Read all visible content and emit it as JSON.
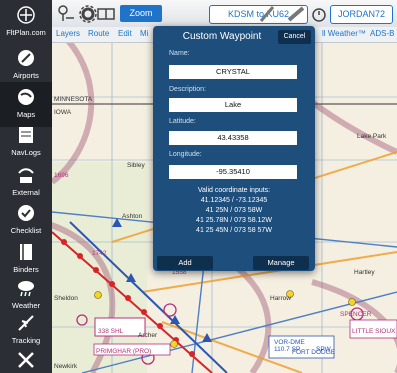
{
  "toolbar": {
    "zoom_label": "Zoom",
    "route_label": "KDSM to KU62",
    "user_label": "JORDAN72"
  },
  "menu": {
    "items": [
      "Layers",
      "Route",
      "Edit",
      "Mi",
      "ll Weather™",
      "ADS-B"
    ]
  },
  "sidebar": {
    "brand": "FltPlan.com",
    "items": [
      {
        "label": "Airports",
        "icon": "airport-icon"
      },
      {
        "label": "Maps",
        "icon": "globe-icon"
      },
      {
        "label": "NavLogs",
        "icon": "navlog-icon"
      },
      {
        "label": "External",
        "icon": "wifi-icon"
      },
      {
        "label": "Checklist",
        "icon": "checklist-icon"
      },
      {
        "label": "Binders",
        "icon": "binder-icon"
      },
      {
        "label": "Weather",
        "icon": "weather-icon"
      },
      {
        "label": "Tracking",
        "icon": "plane-icon"
      },
      {
        "label": "",
        "icon": "tools-icon"
      }
    ]
  },
  "modal": {
    "title": "Custom Waypoint",
    "cancel_label": "Cancel",
    "name_label": "Name:",
    "name_value": "CRYSTAL",
    "description_label": "Description:",
    "description_value": "Lake",
    "latitude_label": "Latitude:",
    "latitude_value": "43.43358",
    "longitude_label": "Longitude:",
    "longitude_value": "-95.35410",
    "valid_title": "Valid coordinate inputs:",
    "valid_lines": [
      "41.12345 / -73.12345",
      "41 25N / 073 58W",
      "41 25.78N / 073 58.12W",
      "41 25 45N / 073 58 57W"
    ],
    "add_label": "Add",
    "manage_label": "Manage"
  },
  "map_labels": {
    "minnesota": "MINNESOTA",
    "iowa": "IOWA",
    "sibley": "Sibley",
    "ashton": "Ashton",
    "sheldon": "Sheldon",
    "primghar": "Primghar",
    "newkirk": "Newkirk",
    "archer": "Archer",
    "harrow": "Harrow",
    "lake_park": "Lake Park",
    "hartley": "Hartley",
    "spencer": "SPENCER",
    "little_sioux": "LITTLE SIOUX",
    "fort_dodge": "FORT DODGE",
    "n1696": "1696",
    "n1742": "1742",
    "n1558": "1558",
    "n1622": "1622",
    "sheldon_freq": "338 SHL",
    "primghar_box": "PRIMGHAR (PRO)",
    "vor_dme": "VOR-DME",
    "freq": "110.7 SP",
    "spw": "SPW"
  },
  "colors": {
    "accent": "#1f73c9",
    "modal_bg": "#1d4e7c",
    "sidebar_bg": "#2b2f35",
    "route": "#d8232a"
  }
}
